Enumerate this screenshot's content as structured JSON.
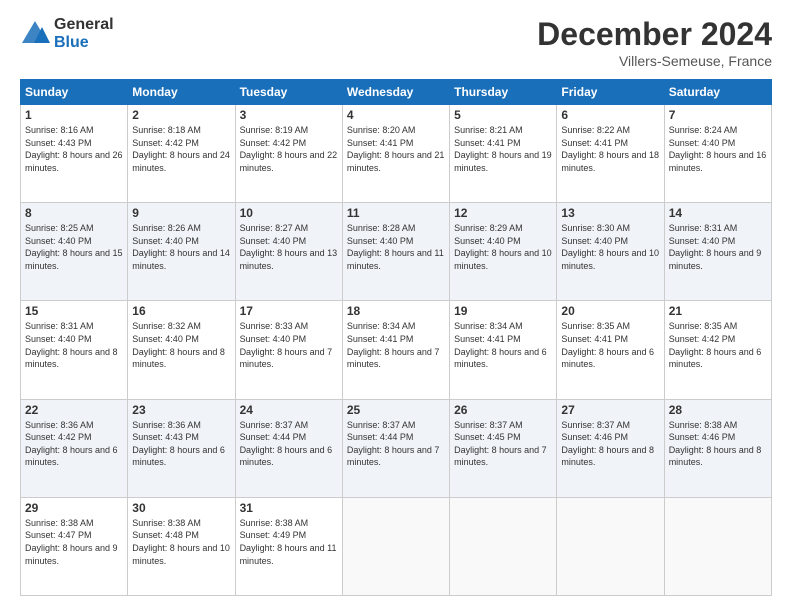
{
  "logo": {
    "general": "General",
    "blue": "Blue"
  },
  "header": {
    "title": "December 2024",
    "location": "Villers-Semeuse, France"
  },
  "weekdays": [
    "Sunday",
    "Monday",
    "Tuesday",
    "Wednesday",
    "Thursday",
    "Friday",
    "Saturday"
  ],
  "weeks": [
    [
      {
        "day": "1",
        "sunrise": "Sunrise: 8:16 AM",
        "sunset": "Sunset: 4:43 PM",
        "daylight": "Daylight: 8 hours and 26 minutes."
      },
      {
        "day": "2",
        "sunrise": "Sunrise: 8:18 AM",
        "sunset": "Sunset: 4:42 PM",
        "daylight": "Daylight: 8 hours and 24 minutes."
      },
      {
        "day": "3",
        "sunrise": "Sunrise: 8:19 AM",
        "sunset": "Sunset: 4:42 PM",
        "daylight": "Daylight: 8 hours and 22 minutes."
      },
      {
        "day": "4",
        "sunrise": "Sunrise: 8:20 AM",
        "sunset": "Sunset: 4:41 PM",
        "daylight": "Daylight: 8 hours and 21 minutes."
      },
      {
        "day": "5",
        "sunrise": "Sunrise: 8:21 AM",
        "sunset": "Sunset: 4:41 PM",
        "daylight": "Daylight: 8 hours and 19 minutes."
      },
      {
        "day": "6",
        "sunrise": "Sunrise: 8:22 AM",
        "sunset": "Sunset: 4:41 PM",
        "daylight": "Daylight: 8 hours and 18 minutes."
      },
      {
        "day": "7",
        "sunrise": "Sunrise: 8:24 AM",
        "sunset": "Sunset: 4:40 PM",
        "daylight": "Daylight: 8 hours and 16 minutes."
      }
    ],
    [
      {
        "day": "8",
        "sunrise": "Sunrise: 8:25 AM",
        "sunset": "Sunset: 4:40 PM",
        "daylight": "Daylight: 8 hours and 15 minutes."
      },
      {
        "day": "9",
        "sunrise": "Sunrise: 8:26 AM",
        "sunset": "Sunset: 4:40 PM",
        "daylight": "Daylight: 8 hours and 14 minutes."
      },
      {
        "day": "10",
        "sunrise": "Sunrise: 8:27 AM",
        "sunset": "Sunset: 4:40 PM",
        "daylight": "Daylight: 8 hours and 13 minutes."
      },
      {
        "day": "11",
        "sunrise": "Sunrise: 8:28 AM",
        "sunset": "Sunset: 4:40 PM",
        "daylight": "Daylight: 8 hours and 11 minutes."
      },
      {
        "day": "12",
        "sunrise": "Sunrise: 8:29 AM",
        "sunset": "Sunset: 4:40 PM",
        "daylight": "Daylight: 8 hours and 10 minutes."
      },
      {
        "day": "13",
        "sunrise": "Sunrise: 8:30 AM",
        "sunset": "Sunset: 4:40 PM",
        "daylight": "Daylight: 8 hours and 10 minutes."
      },
      {
        "day": "14",
        "sunrise": "Sunrise: 8:31 AM",
        "sunset": "Sunset: 4:40 PM",
        "daylight": "Daylight: 8 hours and 9 minutes."
      }
    ],
    [
      {
        "day": "15",
        "sunrise": "Sunrise: 8:31 AM",
        "sunset": "Sunset: 4:40 PM",
        "daylight": "Daylight: 8 hours and 8 minutes."
      },
      {
        "day": "16",
        "sunrise": "Sunrise: 8:32 AM",
        "sunset": "Sunset: 4:40 PM",
        "daylight": "Daylight: 8 hours and 8 minutes."
      },
      {
        "day": "17",
        "sunrise": "Sunrise: 8:33 AM",
        "sunset": "Sunset: 4:40 PM",
        "daylight": "Daylight: 8 hours and 7 minutes."
      },
      {
        "day": "18",
        "sunrise": "Sunrise: 8:34 AM",
        "sunset": "Sunset: 4:41 PM",
        "daylight": "Daylight: 8 hours and 7 minutes."
      },
      {
        "day": "19",
        "sunrise": "Sunrise: 8:34 AM",
        "sunset": "Sunset: 4:41 PM",
        "daylight": "Daylight: 8 hours and 6 minutes."
      },
      {
        "day": "20",
        "sunrise": "Sunrise: 8:35 AM",
        "sunset": "Sunset: 4:41 PM",
        "daylight": "Daylight: 8 hours and 6 minutes."
      },
      {
        "day": "21",
        "sunrise": "Sunrise: 8:35 AM",
        "sunset": "Sunset: 4:42 PM",
        "daylight": "Daylight: 8 hours and 6 minutes."
      }
    ],
    [
      {
        "day": "22",
        "sunrise": "Sunrise: 8:36 AM",
        "sunset": "Sunset: 4:42 PM",
        "daylight": "Daylight: 8 hours and 6 minutes."
      },
      {
        "day": "23",
        "sunrise": "Sunrise: 8:36 AM",
        "sunset": "Sunset: 4:43 PM",
        "daylight": "Daylight: 8 hours and 6 minutes."
      },
      {
        "day": "24",
        "sunrise": "Sunrise: 8:37 AM",
        "sunset": "Sunset: 4:44 PM",
        "daylight": "Daylight: 8 hours and 6 minutes."
      },
      {
        "day": "25",
        "sunrise": "Sunrise: 8:37 AM",
        "sunset": "Sunset: 4:44 PM",
        "daylight": "Daylight: 8 hours and 7 minutes."
      },
      {
        "day": "26",
        "sunrise": "Sunrise: 8:37 AM",
        "sunset": "Sunset: 4:45 PM",
        "daylight": "Daylight: 8 hours and 7 minutes."
      },
      {
        "day": "27",
        "sunrise": "Sunrise: 8:37 AM",
        "sunset": "Sunset: 4:46 PM",
        "daylight": "Daylight: 8 hours and 8 minutes."
      },
      {
        "day": "28",
        "sunrise": "Sunrise: 8:38 AM",
        "sunset": "Sunset: 4:46 PM",
        "daylight": "Daylight: 8 hours and 8 minutes."
      }
    ],
    [
      {
        "day": "29",
        "sunrise": "Sunrise: 8:38 AM",
        "sunset": "Sunset: 4:47 PM",
        "daylight": "Daylight: 8 hours and 9 minutes."
      },
      {
        "day": "30",
        "sunrise": "Sunrise: 8:38 AM",
        "sunset": "Sunset: 4:48 PM",
        "daylight": "Daylight: 8 hours and 10 minutes."
      },
      {
        "day": "31",
        "sunrise": "Sunrise: 8:38 AM",
        "sunset": "Sunset: 4:49 PM",
        "daylight": "Daylight: 8 hours and 11 minutes."
      },
      null,
      null,
      null,
      null
    ]
  ]
}
